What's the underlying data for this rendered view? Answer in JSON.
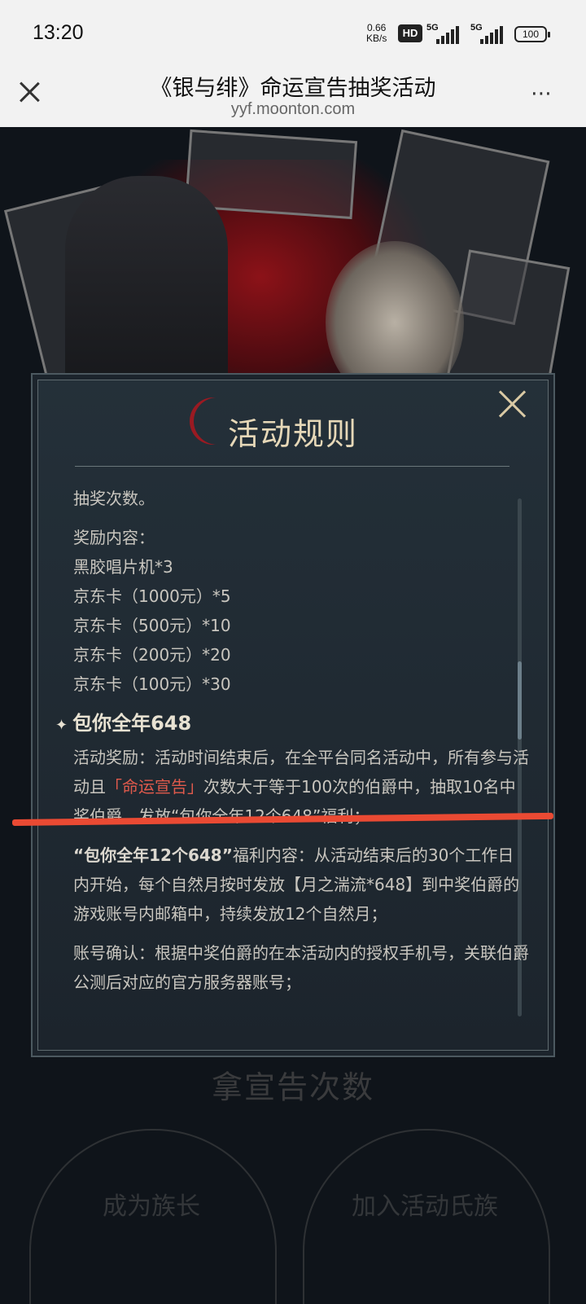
{
  "status_bar": {
    "time": "13:20",
    "net_speed_value": "0.66",
    "net_speed_unit": "KB/s",
    "hd_badge": "HD",
    "signal1_label": "5G",
    "signal2_label": "5G",
    "battery": "100"
  },
  "browser": {
    "title": "《银与绯》命运宣告抽奖活动",
    "url": "yyf.moonton.com",
    "more_icon": "⋯"
  },
  "background": {
    "heading": "拿宣告次数",
    "card_left_label": "成为族长",
    "card_right_label": "加入活动氏族"
  },
  "dialog": {
    "title": "活动规则",
    "lines": {
      "l1": "抽奖次数。",
      "l2": "奖励内容：",
      "l3": "黑胶唱片机*3",
      "l4": "京东卡（1000元）*5",
      "l5": "京东卡（500元）*10",
      "l6": "京东卡（200元）*20",
      "l7": "京东卡（100元）*30"
    },
    "section_title": "包你全年648",
    "p1_a": "活动奖励：活动时间结束后，在全平台同名活动中，所有参与活动且",
    "p1_highlight": "「命运宣告」",
    "p1_b": "次数大于等于100次的伯爵中，抽取10名中奖伯爵，发放“包你全年12个648”福利；",
    "p2_bold": "“包你全年12个648”",
    "p2_rest": "福利内容：从活动结束后的30个工作日内开始，每个自然月按时发放【月之湍流*648】到中奖伯爵的游戏账号内邮箱中，持续发放12个自然月；",
    "p3": "账号确认：根据中奖伯爵的在本活动内的授权手机号，关联伯爵公测后对应的官方服务器账号；"
  }
}
